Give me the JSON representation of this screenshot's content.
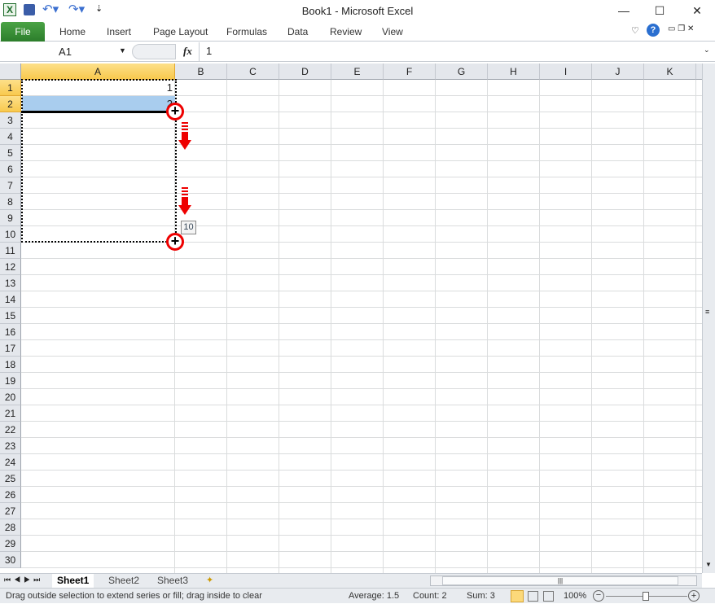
{
  "window": {
    "title": "Book1  -  Microsoft Excel",
    "controls": [
      "—",
      "☐",
      "✕"
    ]
  },
  "quick_access": [
    "save",
    "undo",
    "redo",
    "customize"
  ],
  "ribbon": {
    "file": "File",
    "tabs": [
      "Home",
      "Insert",
      "Page Layout",
      "Formulas",
      "Data",
      "Review",
      "View"
    ]
  },
  "formula_bar": {
    "name_box": "A1",
    "fx": "fx",
    "value": "1"
  },
  "columns": [
    "A",
    "B",
    "C",
    "D",
    "E",
    "F",
    "G",
    "H",
    "I",
    "J",
    "K"
  ],
  "rows": 30,
  "cells": {
    "A1": "1",
    "A2": "2"
  },
  "fill_tooltip": "10",
  "sheets": [
    "Sheet1",
    "Sheet2",
    "Sheet3"
  ],
  "active_sheet": "Sheet1",
  "status": {
    "message": "Drag outside selection to extend series or fill; drag inside to clear",
    "average": "Average: 1.5",
    "count": "Count: 2",
    "sum": "Sum: 3",
    "zoom": "100%"
  },
  "colors": {
    "selection": "#a9cdee",
    "header_selected": "#f8c94e",
    "file_tab": "#2c7d2b",
    "annotation": "#e00000"
  }
}
